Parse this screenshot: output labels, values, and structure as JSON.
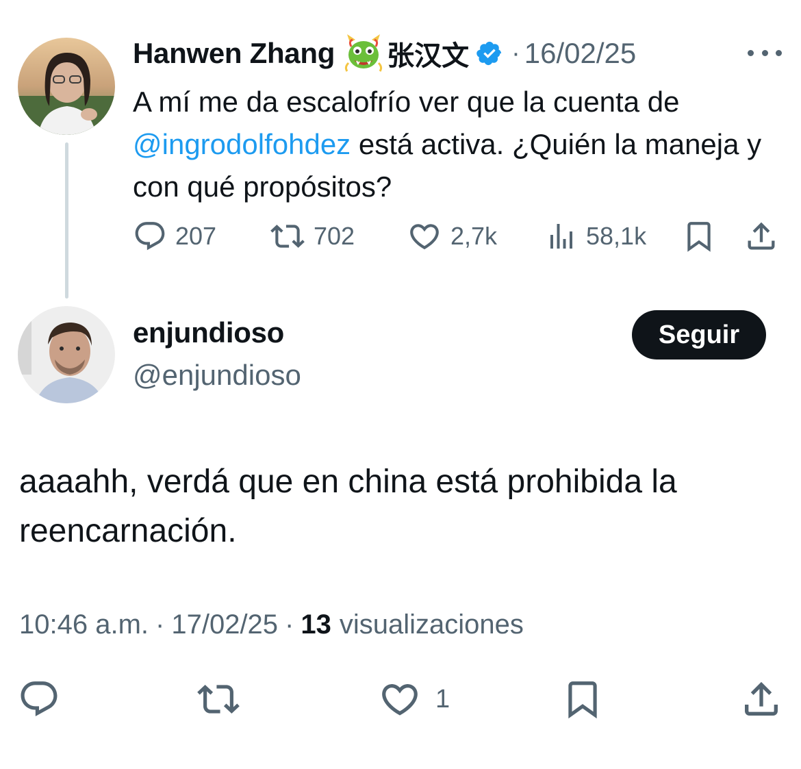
{
  "original_tweet": {
    "display_name": "Hanwen Zhang",
    "emoji_icon": "dragon-face-icon",
    "cjk_name": "张汉文",
    "verified_icon": "verified-badge-icon",
    "separator": "·",
    "date": "16/02/25",
    "text_parts": {
      "before": "A mí me da escalofrío ver que la cuenta de ",
      "mention": "@ingrodolfohdez",
      "after": " está activa. ¿Quién la maneja y con qué propósitos?"
    },
    "actions": {
      "replies": "207",
      "reposts": "702",
      "likes": "2,7k",
      "views": "58,1k"
    }
  },
  "reply_tweet": {
    "display_name": "enjundioso",
    "handle": "@enjundioso",
    "follow_label": "Seguir",
    "text": "aaaahh, verdá que en china está prohibida la reencarnación.",
    "time": "10:46 a.m.",
    "separator": "·",
    "date": "17/02/25",
    "views_count": "13",
    "views_label": "visualizaciones",
    "actions": {
      "likes": "1"
    }
  },
  "colors": {
    "text": "#0f1419",
    "muted": "#536471",
    "link": "#1d9bf0",
    "thread_line": "#cfd9de",
    "button_bg": "#0f1419"
  }
}
